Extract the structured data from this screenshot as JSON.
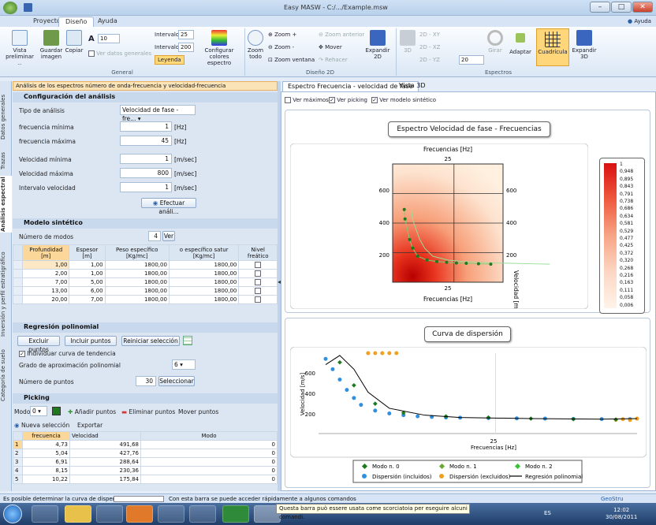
{
  "window": {
    "title": "Easy MASW - C:/.../Example.msw",
    "help_label": "Ayuda"
  },
  "tabs": [
    "Proyecto",
    "Diseño",
    "Ayuda"
  ],
  "ribbon": {
    "general": {
      "label": "General",
      "vista": "Vista preliminar ..",
      "guardar": "Guardar imagen",
      "copiar": "Copiar",
      "font_size": "10",
      "ver_datos": "Ver datos generales",
      "intervalo_label": "Intervalo",
      "intervalo1": "25",
      "intervalo2": "200",
      "leyenda": "Leyenda",
      "configurar": "Configurar colores espectro"
    },
    "diseno2d": {
      "label": "Diseño 2D",
      "zoom_todo": "Zoom todo",
      "zoom_in": "Zoom +",
      "zoom_out": "Zoom -",
      "zoom_ventana": "Zoom ventana",
      "zoom_anterior": "Zoom anterior",
      "mover": "Mover",
      "rehacer": "Rehacer",
      "expandir": "Expandir 2D"
    },
    "espectros": {
      "label": "Espectros",
      "b3d": "3D",
      "xy": "2D - XY",
      "xz": "2D - XZ",
      "yz": "2D - YZ",
      "value": "20",
      "girar": "Girar",
      "adaptar": "Adaptar",
      "cuadricula": "Cuadrícula",
      "expandir3d": "Expandir 3D"
    }
  },
  "left": {
    "header": "Análisis de los espectros número de onda-frecuencia y velocidad-frecuencia",
    "vertical_tabs": [
      "Datos generales",
      "Trazas",
      "Análisis espectral",
      "Inversión y perfil estratigráfico",
      "Categoría de suelo"
    ],
    "config": {
      "title": "Configuración del análisis",
      "tipo_label": "Tipo de análisis",
      "tipo_value": "Velocidad de fase - fre...",
      "fmin_label": "frecuencia mínima",
      "fmin": "1",
      "fmax_label": "frecuencia máxima",
      "fmax": "45",
      "hz": "[Hz]",
      "vmin_label": "Velocidad mínima",
      "vmin": "1",
      "vmax_label": "Velocidad máxima",
      "vmax": "800",
      "vint_label": "Intervalo velocidad",
      "vint": "1",
      "ms": "[m/sec]",
      "efectuar": "Efectuar análi..."
    },
    "modelo": {
      "title": "Modelo sintético",
      "nmodos_label": "Número de modos",
      "nmodos": "4",
      "ver": "Ver",
      "headers": [
        "Profundidad [m]",
        "Espesor [m]",
        "Peso específico [Kg/mc]",
        "o específico satur [Kg/mc]",
        "Nivel freático"
      ],
      "rows": [
        [
          "1,00",
          "1,00",
          "1800,00",
          "1800,00"
        ],
        [
          "2,00",
          "1,00",
          "1800,00",
          "1800,00"
        ],
        [
          "7,00",
          "5,00",
          "1800,00",
          "1800,00"
        ],
        [
          "13,00",
          "6,00",
          "1800,00",
          "1800,00"
        ],
        [
          "20,00",
          "7,00",
          "1800,00",
          "1800,00"
        ]
      ]
    },
    "regresion": {
      "title": "Regresión polinomial",
      "excluir": "Excluir puntos",
      "incluir": "Incluir puntos",
      "reiniciar": "Reiniciar selección",
      "individuar": "Individuar curva de tendencia",
      "grado_label": "Grado de aproximación polinomial",
      "grado": "6",
      "npuntos_label": "Número de puntos",
      "npuntos": "30",
      "seleccionar": "Seleccionar"
    },
    "picking": {
      "title": "Picking",
      "modo_label": "Modo",
      "modo": "0",
      "anadir": "Añadir puntos",
      "eliminar": "Eliminar puntos",
      "mover": "Mover puntos",
      "nueva": "Nueva selección",
      "exportar": "Exportar",
      "headers": [
        "frecuencia",
        "Velocidad",
        "Modo"
      ],
      "rows": [
        [
          "1",
          "4,73",
          "491,68",
          "0"
        ],
        [
          "2",
          "5,04",
          "427,76",
          "0"
        ],
        [
          "3",
          "6,91",
          "288,64",
          "0"
        ],
        [
          "4",
          "8,15",
          "230,36",
          "0"
        ],
        [
          "5",
          "10,22",
          "175,84",
          "0"
        ]
      ]
    }
  },
  "right": {
    "tabs": [
      "Espectro Frecuencia - velocidad de fase",
      "Vista 3D"
    ],
    "checks": [
      "Ver máximos",
      "Ver picking",
      "Ver modelo sintético"
    ],
    "spectrum": {
      "title": "Espectro Velocidad de fase - Frecuencias",
      "xlabel": "Frecuencias [Hz]",
      "ylabel": "Velocidad [m/s]",
      "xtick": "25",
      "yticks": [
        "600",
        "400",
        "200"
      ]
    },
    "colorbar": [
      "1",
      "0,948",
      "0,895",
      "0,843",
      "0,791",
      "0,738",
      "0,686",
      "0,634",
      "0,581",
      "0,529",
      "0,477",
      "0,425",
      "0,372",
      "0,320",
      "0,268",
      "0,216",
      "0,163",
      "0,111",
      "0,058",
      "0,006"
    ],
    "dispersion": {
      "title": "Curva de dispersión",
      "xlabel": "Frecuencias [Hz]",
      "ylabel": "Velocidad [m/s]",
      "xtick": "25",
      "yticks": [
        "600",
        "400",
        "200"
      ],
      "legend": [
        "Modo n. 0",
        "Modo n. 1",
        "Modo n. 2",
        "Dispersión (incluidos)",
        "Dispersión (excluidos)",
        "Regresión polinomial"
      ]
    }
  },
  "colors": {
    "accent": "#f5a623",
    "modo0": "#1f7a1f",
    "modo1": "#6aa832",
    "modo2": "#35c335",
    "incluidos": "#2f8fe0",
    "excluidos": "#f0a020",
    "regresion": "#000000"
  },
  "chart_data": [
    {
      "type": "heatmap",
      "title": "Espectro Velocidad de fase - Frecuencias",
      "xlabel": "Frecuencias [Hz]",
      "ylabel": "Velocidad [m/s]",
      "ylim": [
        0,
        800
      ],
      "colorbar": {
        "min": 0.006,
        "max": 1
      },
      "picked_curve": {
        "x": [
          4.73,
          5.04,
          6.91,
          8.15,
          10.22,
          14,
          18,
          22,
          26,
          30,
          35,
          40
        ],
        "y": [
          491.68,
          427.76,
          288.64,
          230.36,
          175.84,
          150,
          140,
          135,
          130,
          128,
          125,
          122
        ]
      }
    },
    {
      "type": "scatter",
      "title": "Curva de dispersión",
      "xlabel": "Frecuencias [Hz]",
      "ylabel": "Velocidad [m/s]",
      "ylim": [
        0,
        700
      ],
      "series": [
        {
          "name": "Dispersión (incluidos)",
          "x": [
            1,
            2,
            3,
            4,
            5,
            6,
            8,
            10,
            12,
            14,
            16,
            18,
            20,
            24,
            28,
            32,
            36,
            40,
            44
          ],
          "y": [
            650,
            560,
            470,
            380,
            310,
            250,
            200,
            175,
            160,
            150,
            145,
            140,
            138,
            135,
            132,
            130,
            128,
            126,
            125
          ]
        },
        {
          "name": "Dispersión (excluidos)",
          "x": [
            7,
            8,
            9,
            10,
            11,
            42,
            43,
            44,
            45
          ],
          "y": [
            760,
            760,
            760,
            760,
            760,
            120,
            125,
            118,
            130
          ]
        },
        {
          "name": "Modo n. 0",
          "x": [
            3,
            5,
            8,
            12,
            18,
            24,
            30,
            36,
            42
          ],
          "y": [
            620,
            420,
            260,
            180,
            150,
            140,
            130,
            125,
            122
          ]
        },
        {
          "name": "Regresión polinomial",
          "x": [
            1,
            3,
            5,
            7,
            10,
            15,
            20,
            30,
            40,
            45
          ],
          "y": [
            600,
            680,
            560,
            360,
            220,
            160,
            140,
            130,
            125,
            130
          ]
        }
      ]
    }
  ]
}
